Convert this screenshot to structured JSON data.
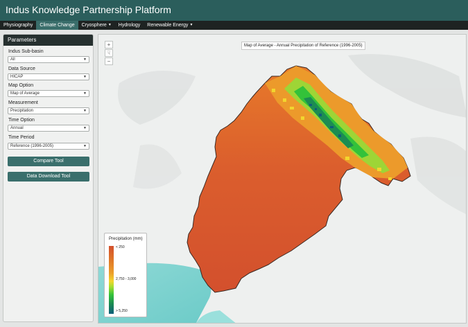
{
  "header": {
    "title": "Indus Knowledge Partnership Platform"
  },
  "nav": {
    "items": [
      {
        "label": "Physiography",
        "caret": ""
      },
      {
        "label": "Climate Change",
        "caret": ""
      },
      {
        "label": "Cryosphere",
        "caret": "▼"
      },
      {
        "label": "Hydrology",
        "caret": ""
      },
      {
        "label": "Renewable Energy",
        "caret": "▼"
      }
    ],
    "active": "Climate Change"
  },
  "panel": {
    "title": "Parameters",
    "fields": [
      {
        "label": "Indus Sub-basin",
        "value": "All"
      },
      {
        "label": "Data Source",
        "value": "HICAP"
      },
      {
        "label": "Map Option",
        "value": "Map of Average"
      },
      {
        "label": "Measurement",
        "value": "Precipitation"
      },
      {
        "label": "Time Option",
        "value": "Annual"
      },
      {
        "label": "Time Period",
        "value": "Reference (1996-2005)"
      }
    ],
    "select_arrow": "▼",
    "buttons": {
      "compare": "Compare Tool",
      "download": "Data Download Tool"
    }
  },
  "map": {
    "title": "Map of Average - Annual Precipitation of Reference (1996-2005)",
    "zoom_in": "+",
    "pan": "☟",
    "zoom_out": "−",
    "legend": {
      "title": "Precipitation (mm)",
      "labels": [
        "< 250",
        "2,750 - 3,000",
        "> 5,250"
      ],
      "level_fraction_of_middle_label": 0.5
    },
    "colors": {
      "low": "#d3502d",
      "mid": "#ec9f2b",
      "high_green": "#33c23a",
      "highest": "#0e5d7a",
      "sea": "#7fd3d1",
      "land": "#eef0ef"
    }
  }
}
